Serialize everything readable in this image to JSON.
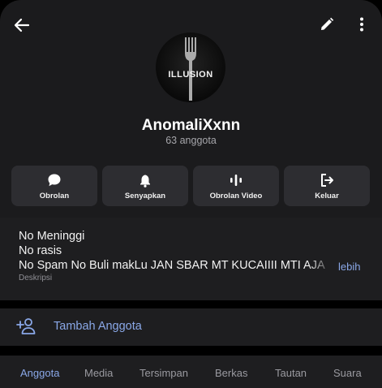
{
  "header": {
    "back_icon": "arrow-left-icon",
    "edit_icon": "pencil-icon",
    "more_icon": "more-vertical-icon"
  },
  "group": {
    "avatar_text": "ILLUSION",
    "name": "AnomaliXxnn",
    "members": "63 anggota"
  },
  "actions": [
    {
      "label": "Obrolan",
      "icon": "chat-bubble-icon"
    },
    {
      "label": "Senyapkan",
      "icon": "bell-icon"
    },
    {
      "label": "Obrolan Video",
      "icon": "audio-wave-icon"
    },
    {
      "label": "Keluar",
      "icon": "logout-icon"
    }
  ],
  "description": {
    "lines": [
      "No Meninggi",
      "No rasis",
      "No Spam No Buli makLu JAN SBAR MT KUCAIIII MTI AJA"
    ],
    "label": "Deskripsi",
    "more": "lebih"
  },
  "add_member": {
    "label": "Tambah Anggota",
    "icon": "add-person-icon"
  },
  "tabs": [
    {
      "label": "Anggota",
      "active": true
    },
    {
      "label": "Media",
      "active": false
    },
    {
      "label": "Tersimpan",
      "active": false
    },
    {
      "label": "Berkas",
      "active": false
    },
    {
      "label": "Tautan",
      "active": false
    },
    {
      "label": "Suara",
      "active": false
    }
  ],
  "colors": {
    "accent": "#8aa8e8",
    "background": "#1b1b1d",
    "button": "#2d2d31"
  }
}
